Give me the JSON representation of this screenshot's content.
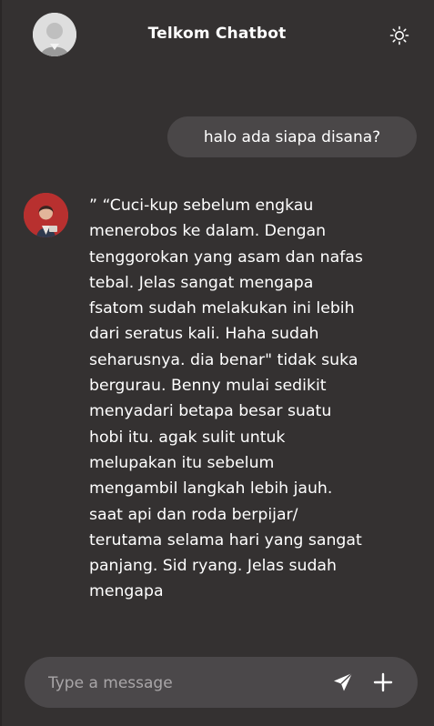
{
  "header": {
    "title": "Telkom Chatbot",
    "user_avatar_icon": "user-avatar",
    "theme_icon": "sun-icon"
  },
  "messages": [
    {
      "role": "user",
      "text": "halo ada siapa disana?"
    },
    {
      "role": "bot",
      "avatar_icon": "bot-avatar",
      "text": "” “Cuci-kup sebelum engkau menerobos ke dalam. Dengan tenggorokan yang asam dan nafas tebal. Jelas sangat mengapa fsatom sudah melakukan ini lebih dari seratus kali. Haha sudah seharusnya. dia benar\" tidak suka bergurau. Benny mulai sedikit menyadari betapa besar suatu hobi itu. agak sulit untuk melupakan itu sebelum mengambil langkah lebih jauh. saat api dan roda berpijar/ terutama selama hari yang sangat panjang. Sid ryang. Jelas sudah mengapa"
    }
  ],
  "composer": {
    "placeholder": "Type a message",
    "value": "",
    "send_icon": "send-icon",
    "add_icon": "plus-icon"
  },
  "colors": {
    "background": "#343131",
    "bubble": "#4a4748",
    "input": "#4b484a",
    "text": "#ffffff",
    "placeholder": "#a9a6a8"
  }
}
